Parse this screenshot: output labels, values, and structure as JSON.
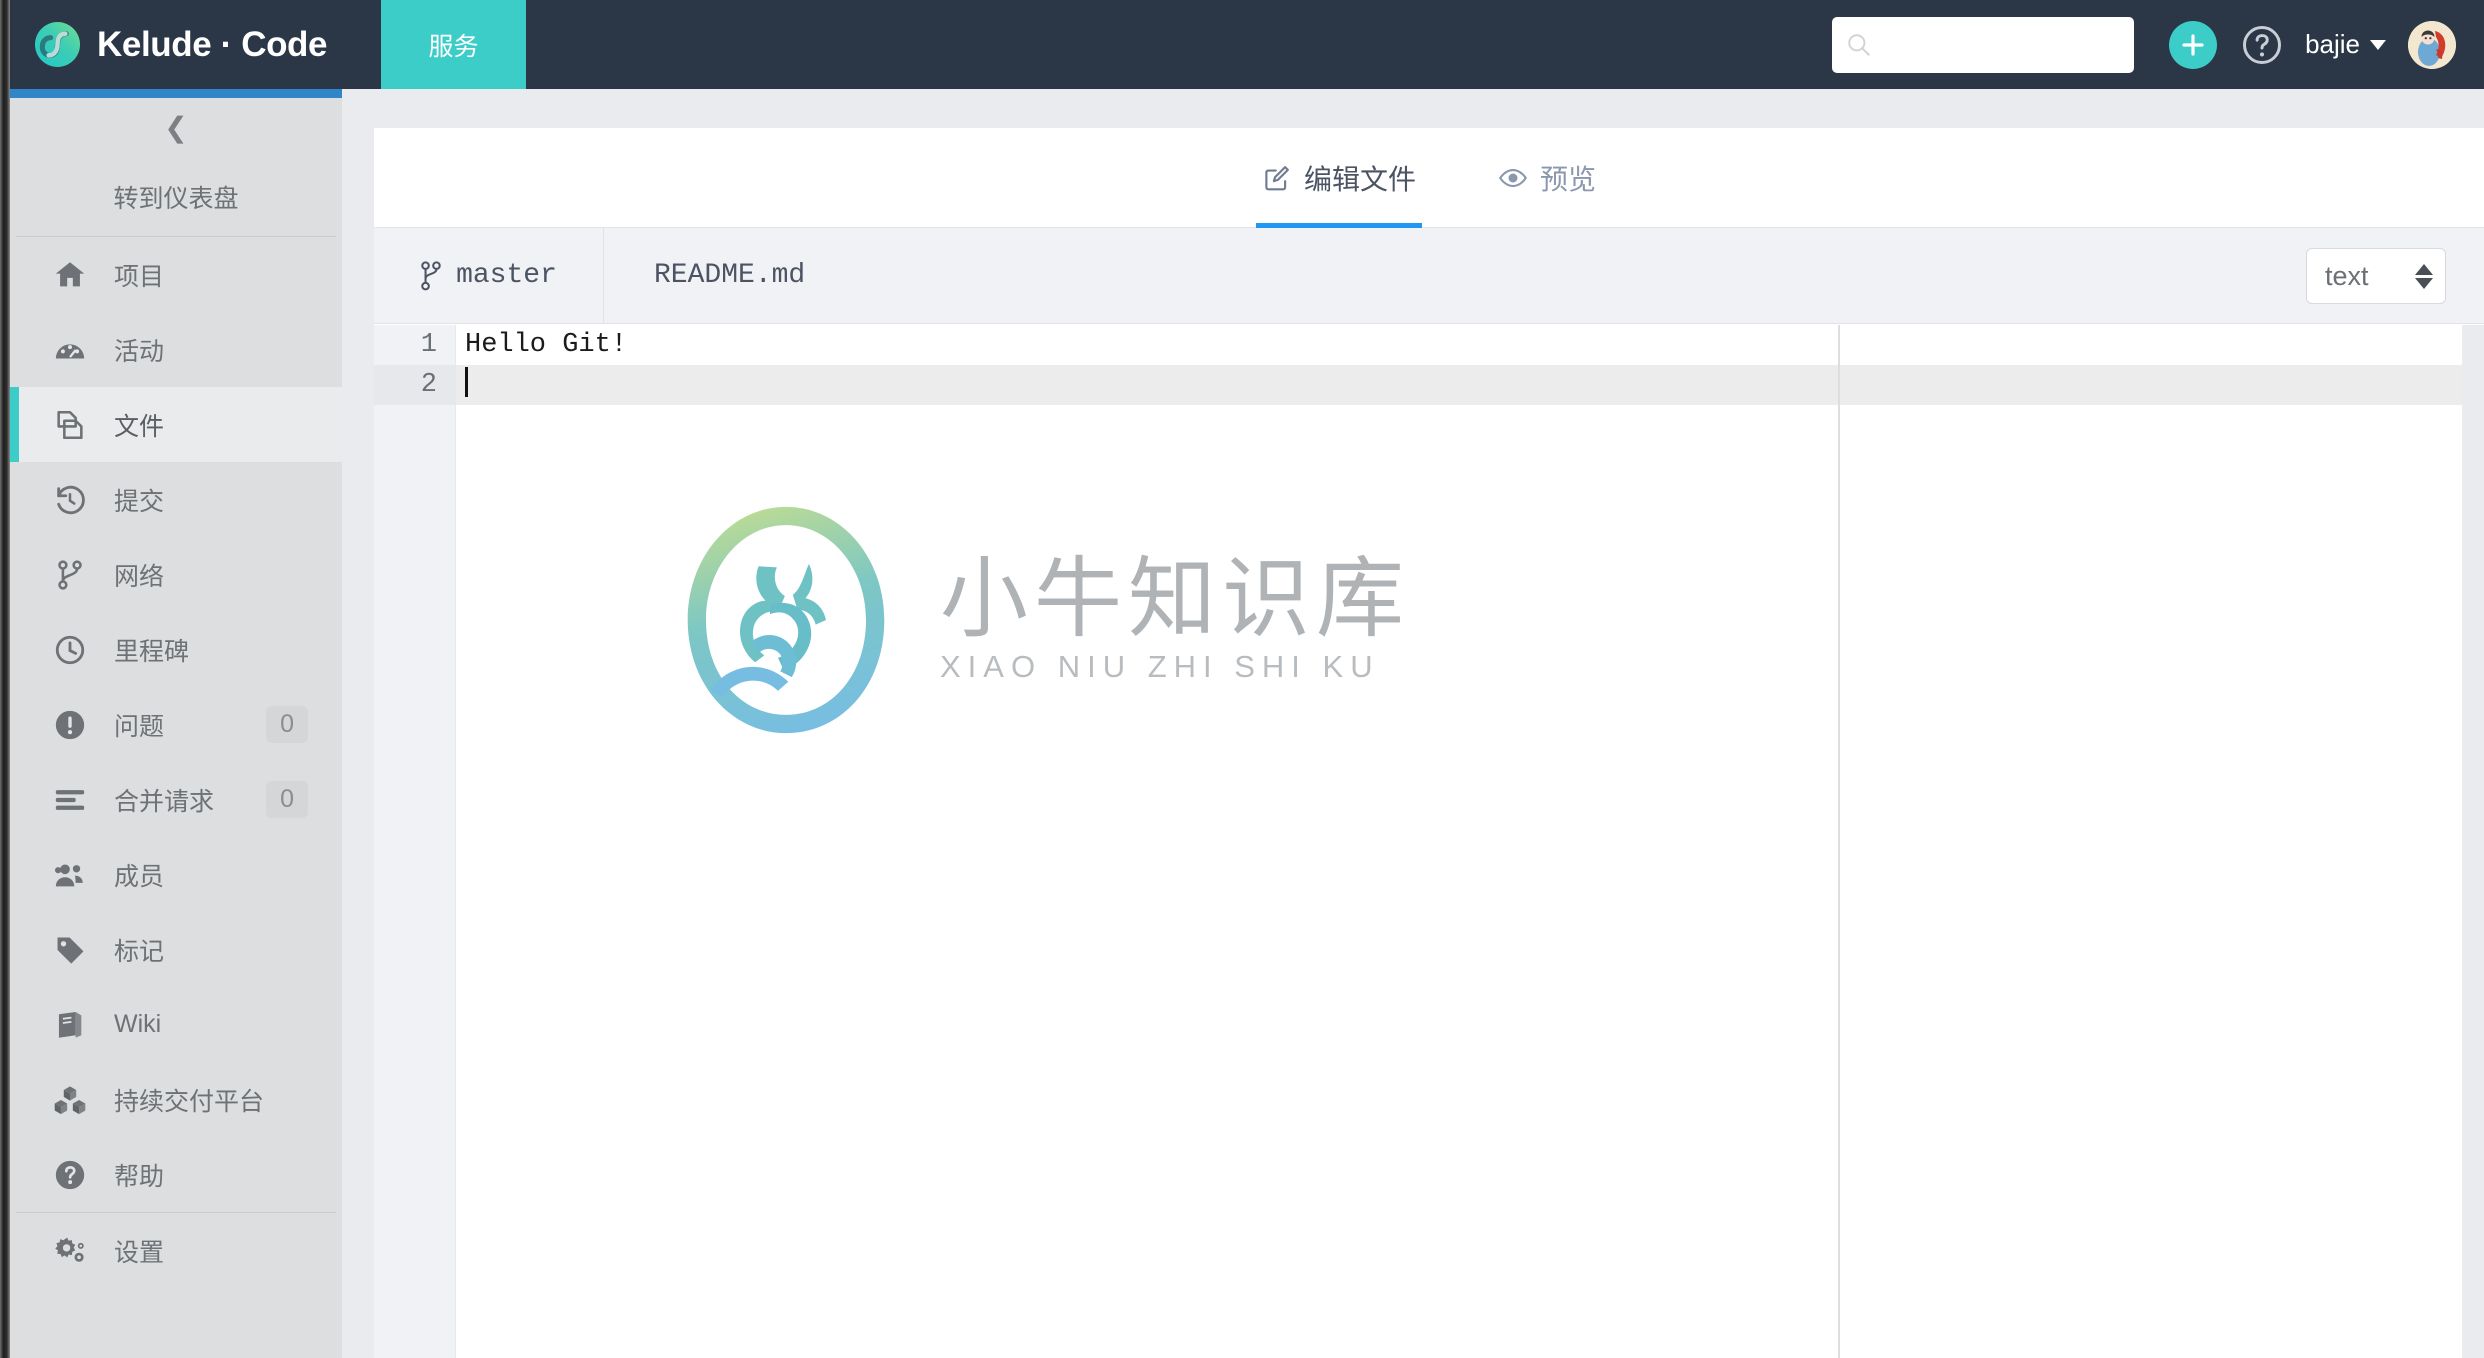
{
  "header": {
    "brand_name": "Kelude · Code",
    "brand_logo_icon": "kelude-loop-logo",
    "nav_service_label": "服务",
    "search": {
      "value": "",
      "placeholder": "",
      "icon": "search-icon"
    },
    "new_button_icon": "plus-icon",
    "help_button_icon": "question-circle-icon",
    "user_name": "bajie",
    "user_caret_icon": "caret-down-icon",
    "avatar_icon": "user-avatar"
  },
  "sidebar": {
    "collapse_icon": "chevron-left-icon",
    "dashboard_label": "转到仪表盘",
    "items": [
      {
        "label": "项目",
        "icon": "home-icon",
        "count": "",
        "active": false
      },
      {
        "label": "活动",
        "icon": "dashboard-icon",
        "count": "",
        "active": false
      },
      {
        "label": "文件",
        "icon": "files-icon",
        "count": "",
        "active": true
      },
      {
        "label": "提交",
        "icon": "history-icon",
        "count": "",
        "active": false
      },
      {
        "label": "网络",
        "icon": "branch-icon",
        "count": "",
        "active": false
      },
      {
        "label": "里程碑",
        "icon": "clock-icon",
        "count": "",
        "active": false
      },
      {
        "label": "问题",
        "icon": "exclamation-icon",
        "count": "0",
        "active": false
      },
      {
        "label": "合并请求",
        "icon": "merge-list-icon",
        "count": "0",
        "active": false
      },
      {
        "label": "成员",
        "icon": "users-icon",
        "count": "",
        "active": false
      },
      {
        "label": "标记",
        "icon": "tag-icon",
        "count": "",
        "active": false
      },
      {
        "label": "Wiki",
        "icon": "book-icon",
        "count": "",
        "active": false
      },
      {
        "label": "持续交付平台",
        "icon": "cubes-icon",
        "count": "",
        "active": false
      },
      {
        "label": "帮助",
        "icon": "question-circle-icon",
        "count": "",
        "active": false
      },
      {
        "label": "设置",
        "icon": "gears-icon",
        "count": "",
        "active": false
      }
    ]
  },
  "main": {
    "tabs": [
      {
        "label": "编辑文件",
        "icon": "edit-pencil-icon",
        "active": true
      },
      {
        "label": "预览",
        "icon": "eye-icon",
        "active": false
      }
    ],
    "filebar": {
      "branch_icon": "branch-icon",
      "branch_name": "master",
      "file_name": "README.md",
      "format_value": "text"
    },
    "editor": {
      "lines": [
        {
          "number": "1",
          "text": "Hello Git!",
          "active": false
        },
        {
          "number": "2",
          "text": "",
          "active": true
        }
      ]
    },
    "watermark": {
      "cn_text": "小牛知识库",
      "en_text": "XIAO NIU ZHI SHI KU",
      "mark_icon": "xiaoniu-deer-logo"
    }
  },
  "colors": {
    "header_bg": "#2b3647",
    "accent_teal": "#3ccdc8",
    "accent_blue": "#3086c8",
    "tab_active_underline": "#2196f3",
    "sidebar_bg": "#dcdedf"
  }
}
